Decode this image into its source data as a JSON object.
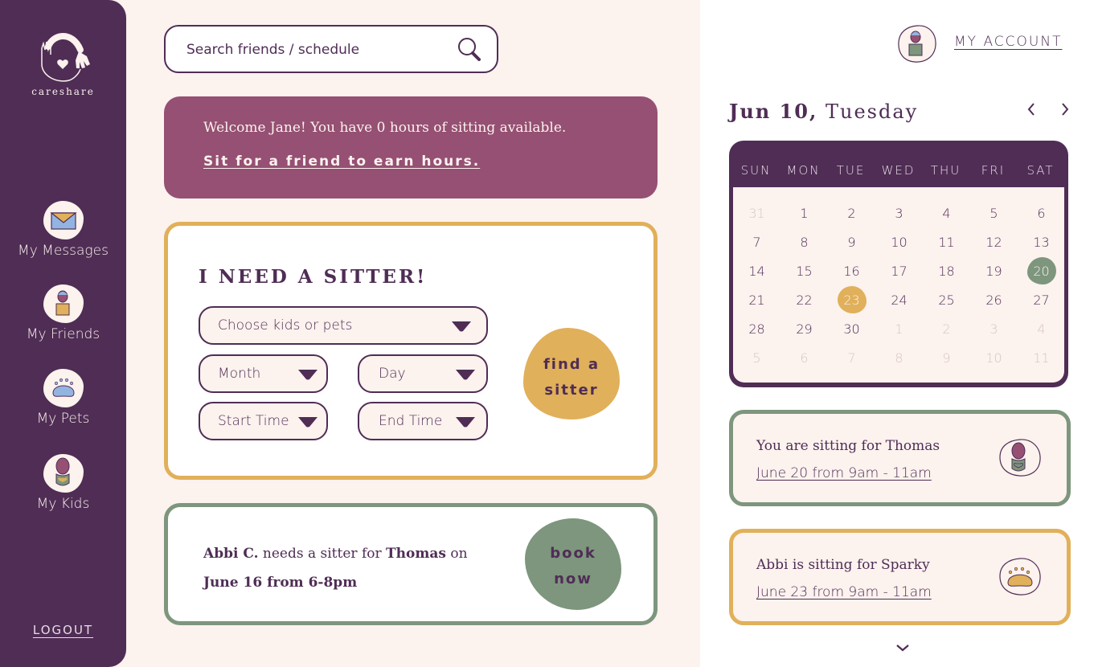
{
  "app": {
    "name": "careshare"
  },
  "sidebar": {
    "items": [
      {
        "label": "My Messages",
        "icon": "envelope-icon"
      },
      {
        "label": "My Friends",
        "icon": "friend-icon"
      },
      {
        "label": "My Pets",
        "icon": "paw-icon"
      },
      {
        "label": "My Kids",
        "icon": "baby-icon"
      }
    ],
    "logout_label": "LOGOUT"
  },
  "search": {
    "placeholder": "Search friends / schedule",
    "value": ""
  },
  "welcome": {
    "message": "Welcome Jane! You have 0 hours of sitting available.",
    "link": "Sit for a friend to earn hours."
  },
  "sitter_form": {
    "title": "I NEED A SITTER!",
    "selects": {
      "who": "Choose kids or pets",
      "month": "Month",
      "day": "Day",
      "start_time": "Start Time",
      "end_time": "End Time"
    },
    "button_line1": "find a",
    "button_line2": "sitter"
  },
  "request": {
    "requester": "Abbi C.",
    "text1": " needs a sitter for ",
    "child": "Thomas",
    "text2": " on",
    "when": "June 16 from 6-8pm",
    "button_line1": "book",
    "button_line2": "now"
  },
  "account": {
    "label": "MY ACCOUNT"
  },
  "calendar": {
    "date_bold": "Jun 10,",
    "weekday": " Tuesday",
    "weekdays": [
      "SUN",
      "MON",
      "TUE",
      "WED",
      "THU",
      "FRI",
      "SAT"
    ],
    "days": [
      {
        "d": "31",
        "muted": true
      },
      {
        "d": "1"
      },
      {
        "d": "2"
      },
      {
        "d": "3"
      },
      {
        "d": "4"
      },
      {
        "d": "5"
      },
      {
        "d": "6"
      },
      {
        "d": "7"
      },
      {
        "d": "8"
      },
      {
        "d": "9"
      },
      {
        "d": "10"
      },
      {
        "d": "11"
      },
      {
        "d": "12"
      },
      {
        "d": "13"
      },
      {
        "d": "14"
      },
      {
        "d": "15"
      },
      {
        "d": "16"
      },
      {
        "d": "17"
      },
      {
        "d": "18"
      },
      {
        "d": "19"
      },
      {
        "d": "20",
        "mark": "green"
      },
      {
        "d": "21"
      },
      {
        "d": "22"
      },
      {
        "d": "23",
        "mark": "gold"
      },
      {
        "d": "24"
      },
      {
        "d": "25"
      },
      {
        "d": "26"
      },
      {
        "d": "27"
      },
      {
        "d": "28"
      },
      {
        "d": "29"
      },
      {
        "d": "30"
      },
      {
        "d": "1",
        "muted": true
      },
      {
        "d": "2",
        "muted": true
      },
      {
        "d": "3",
        "muted": true
      },
      {
        "d": "4",
        "muted": true
      },
      {
        "d": "5",
        "muted": true
      },
      {
        "d": "6",
        "muted": true
      },
      {
        "d": "7",
        "muted": true
      },
      {
        "d": "8",
        "muted": true
      },
      {
        "d": "9",
        "muted": true
      },
      {
        "d": "10",
        "muted": true
      },
      {
        "d": "11",
        "muted": true
      }
    ]
  },
  "events": [
    {
      "title": "You are sitting for Thomas",
      "time": "June 20 from 9am - 11am",
      "icon": "baby-icon",
      "color": "#7d967d"
    },
    {
      "title": "Abbi is sitting for Sparky",
      "time": "June 23 from 9am - 11am",
      "icon": "paw-icon",
      "color": "#e0b05a"
    }
  ],
  "colors": {
    "primary": "#4f2d55",
    "accent_mauve": "#955073",
    "accent_gold": "#e0b05a",
    "accent_green": "#7d967d",
    "background": "#fcf2ee"
  }
}
